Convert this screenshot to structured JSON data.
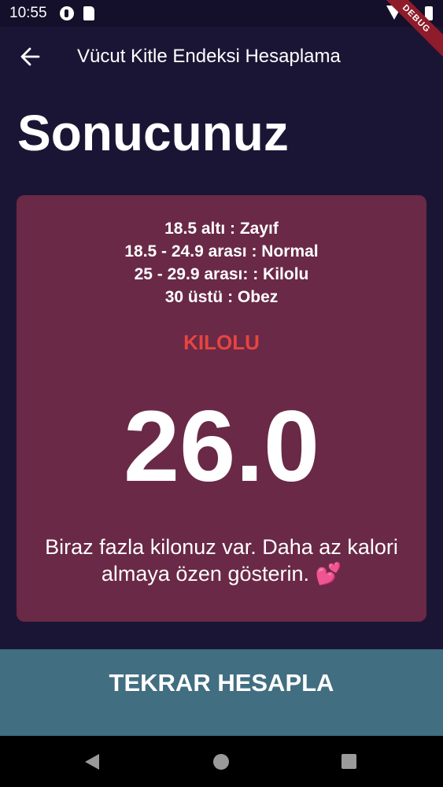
{
  "status_bar": {
    "time": "10:55",
    "debug_label": "DEBUG"
  },
  "app_bar": {
    "title": "Vücut Kitle Endeksi Hesaplama",
    "back_icon": "arrow-left-icon"
  },
  "page": {
    "title": "Sonucunuz"
  },
  "result": {
    "ranges": [
      "18.5 altı : Zayıf",
      "18.5 - 24.9 arası : Normal",
      "25 - 29.9 arası: : Kilolu",
      "30 üstü : Obez"
    ],
    "category": "KILOLU",
    "bmi": "26.0",
    "message": "Biraz fazla kilonuz var. Daha az kalori almaya özen gösterin. 💕"
  },
  "action": {
    "label": "TEKRAR HESAPLA"
  },
  "colors": {
    "background": "#1b1535",
    "card": "#6a2946",
    "category": "#e6453f",
    "button": "#416e80"
  }
}
